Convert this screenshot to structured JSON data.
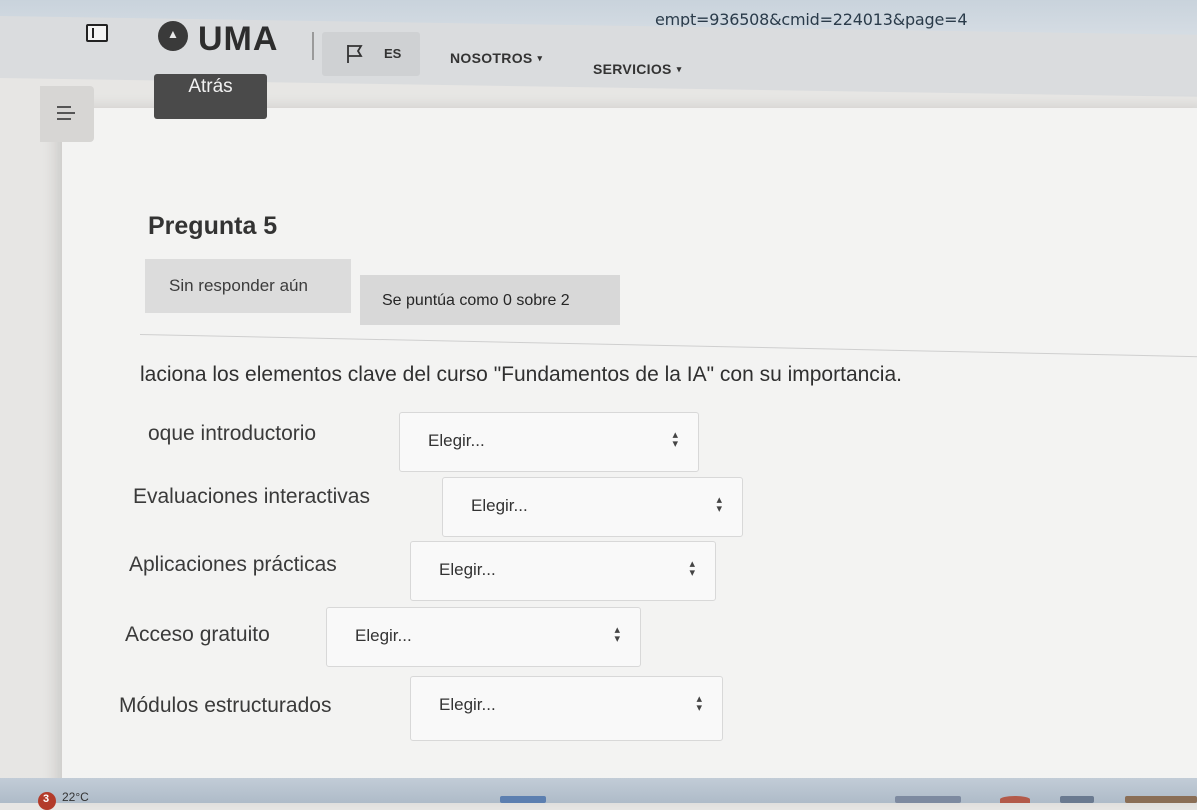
{
  "browser": {
    "url_fragment": "empt=936508&cmid=224013&page=4"
  },
  "nav": {
    "brand": "UMA",
    "lang_label": "ES",
    "menu_items": [
      {
        "label": "NOSOTROS",
        "caret": "▾"
      },
      {
        "label": "SERVICIOS",
        "caret": "▾"
      }
    ]
  },
  "back_button": "Atrás",
  "question": {
    "title": "Pregunta 5",
    "status": "Sin responder aún",
    "grade": "Se puntúa como 0 sobre 2",
    "prompt": "laciona los elementos clave del curso \"Fundamentos de la IA\" con su importancia.",
    "rows": [
      {
        "label": "oque introductorio",
        "selected": "Elegir..."
      },
      {
        "label": "Evaluaciones interactivas",
        "selected": "Elegir..."
      },
      {
        "label": "Aplicaciones prácticas",
        "selected": "Elegir..."
      },
      {
        "label": "Acceso gratuito",
        "selected": "Elegir..."
      },
      {
        "label": "Módulos estructurados",
        "selected": "Elegir..."
      }
    ]
  },
  "taskbar": {
    "notification_count": "3",
    "temperature": "22°C"
  },
  "colors": {
    "back_button_bg": "#4a4a4a",
    "page_bg": "#f3f3f2",
    "chip_bg": "#dcdcdc"
  }
}
